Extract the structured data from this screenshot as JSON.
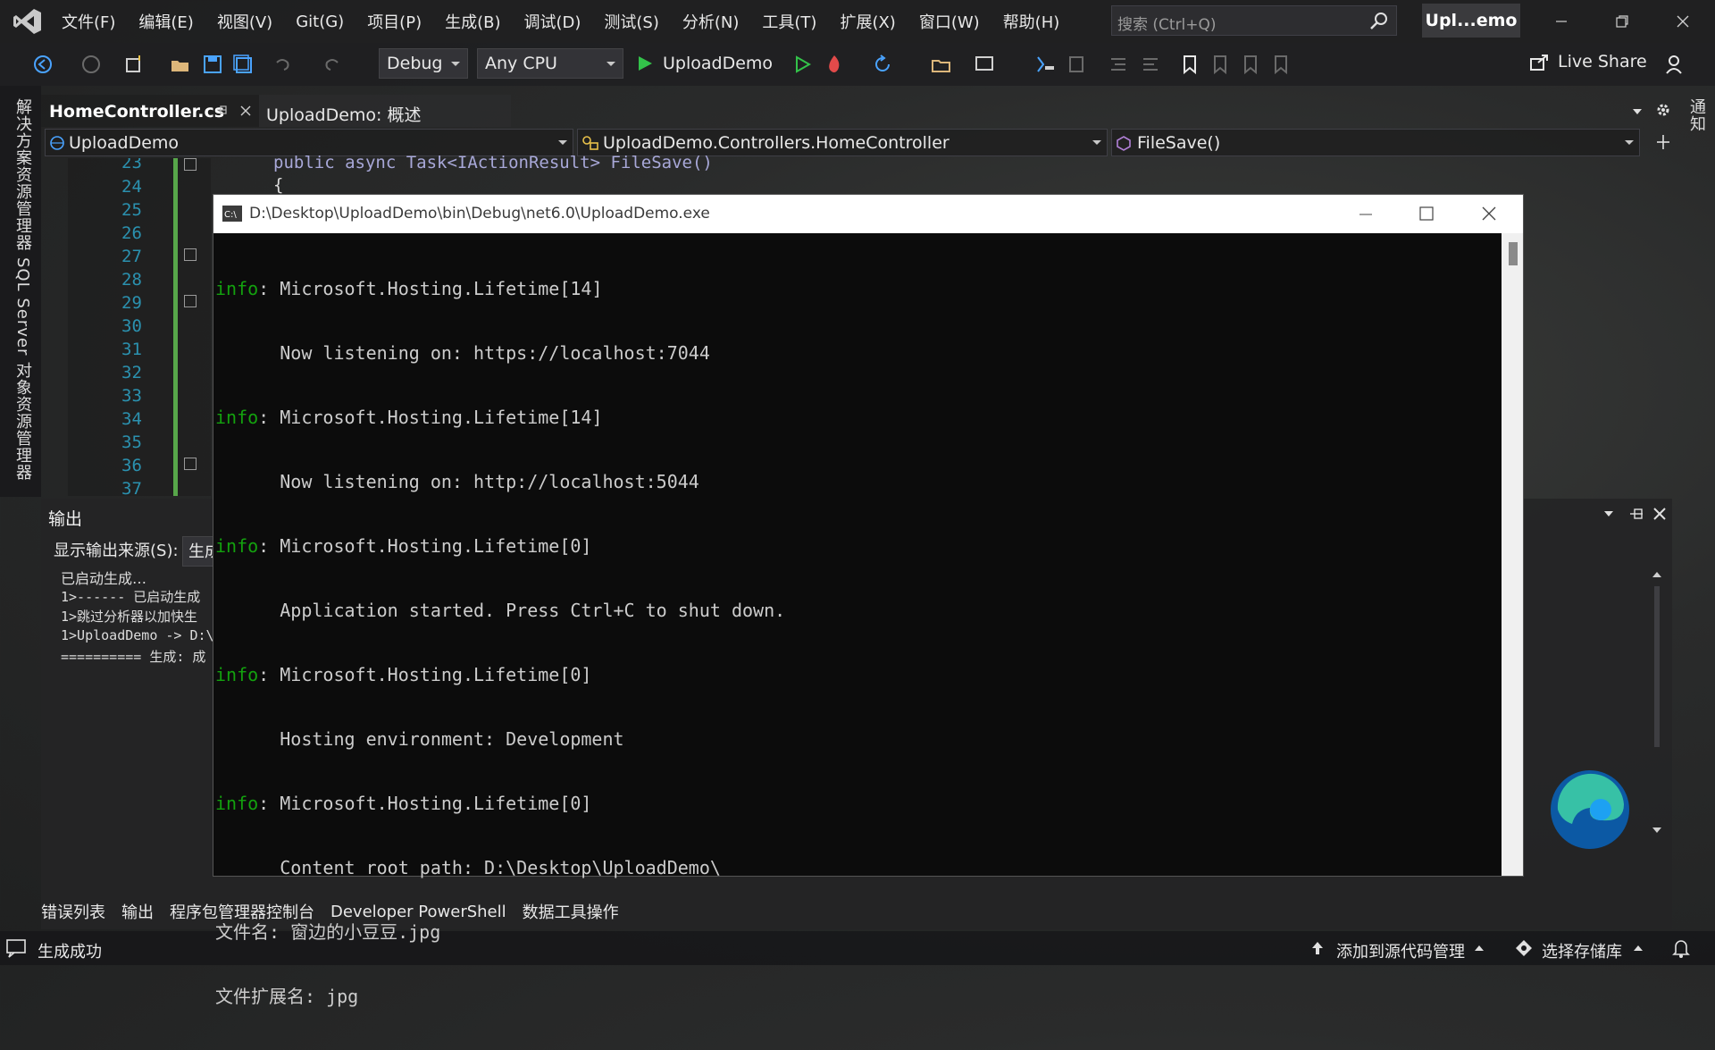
{
  "menubar": {
    "items": [
      "文件(F)",
      "编辑(E)",
      "视图(V)",
      "Git(G)",
      "项目(P)",
      "生成(B)",
      "调试(D)",
      "测试(S)",
      "分析(N)",
      "工具(T)",
      "扩展(X)",
      "窗口(W)",
      "帮助(H)"
    ],
    "search_placeholder": "搜索 (Ctrl+Q)",
    "title_badge": "Upl...emo"
  },
  "toolbar": {
    "configuration": "Debug",
    "platform": "Any CPU",
    "run_target": "UploadDemo",
    "live_share": "Live Share"
  },
  "left_rail": {
    "solution_explorer": "解决方案资源管理器",
    "sql_explorer": "SQL Server 对象资源管理器"
  },
  "right_rail": {
    "notifications": "通知"
  },
  "tabs": {
    "active": "HomeController.cs",
    "inactive": "UploadDemo: 概述"
  },
  "navbar": {
    "project": "UploadDemo",
    "class": "UploadDemo.Controllers.HomeController",
    "member": "FileSave()"
  },
  "editor": {
    "line_numbers": [
      "23",
      "24",
      "25",
      "26",
      "27",
      "28",
      "29",
      "30",
      "31",
      "32",
      "33",
      "34",
      "35",
      "36",
      "37"
    ],
    "code_line_1": "public async Task<IActionResult> FileSave()",
    "code_line_2": "{"
  },
  "output_panel": {
    "title": "输出",
    "source_label": "显示输出来源(S):",
    "source_value": "生成",
    "lines": [
      "已启动生成…",
      "1>------ 已启动生成",
      "1>跳过分析器以加快生",
      "1>UploadDemo -> D:\\",
      "========== 生成: 成"
    ]
  },
  "bottom_tabs": [
    "错误列表",
    "输出",
    "程序包管理器控制台",
    "Developer PowerShell",
    "数据工具操作"
  ],
  "statusbar": {
    "status": "生成成功",
    "source_control": "添加到源代码管理",
    "repository": "选择存储库"
  },
  "console": {
    "title": "D:\\Desktop\\UploadDemo\\bin\\Debug\\net6.0\\UploadDemo.exe",
    "lines": [
      {
        "prefix": "info",
        "text": ": Microsoft.Hosting.Lifetime[14]"
      },
      {
        "prefix": "",
        "text": "      Now listening on: https://localhost:7044"
      },
      {
        "prefix": "info",
        "text": ": Microsoft.Hosting.Lifetime[14]"
      },
      {
        "prefix": "",
        "text": "      Now listening on: http://localhost:5044"
      },
      {
        "prefix": "info",
        "text": ": Microsoft.Hosting.Lifetime[0]"
      },
      {
        "prefix": "",
        "text": "      Application started. Press Ctrl+C to shut down."
      },
      {
        "prefix": "info",
        "text": ": Microsoft.Hosting.Lifetime[0]"
      },
      {
        "prefix": "",
        "text": "      Hosting environment: Development"
      },
      {
        "prefix": "info",
        "text": ": Microsoft.Hosting.Lifetime[0]"
      },
      {
        "prefix": "",
        "text": "      Content root path: D:\\Desktop\\UploadDemo\\"
      },
      {
        "prefix": "",
        "text": "文件名: 窗边的小豆豆.jpg"
      },
      {
        "prefix": "",
        "text": "文件扩展名: jpg"
      }
    ]
  },
  "colors": {
    "accent_green": "#13a10e",
    "vs_purple": "#68217a",
    "line_number_blue": "#2b91af"
  }
}
